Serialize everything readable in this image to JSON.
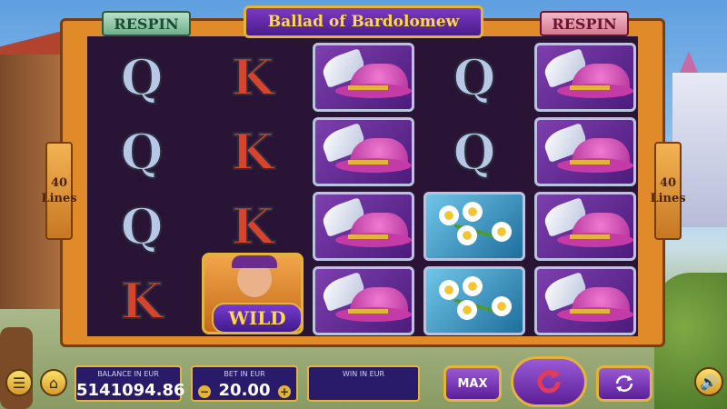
{
  "game": {
    "title": "Ballad of Bardolomew",
    "respin_left": "RESPIN",
    "respin_right": "RESPIN",
    "lines_left": {
      "count": "40",
      "label": "Lines"
    },
    "lines_right": {
      "count": "40",
      "label": "Lines"
    }
  },
  "reels": [
    [
      "Q",
      "Q",
      "Q",
      "K"
    ],
    [
      "K",
      "K",
      "K",
      "wild"
    ],
    [
      "hat",
      "hat",
      "hat",
      "hat"
    ],
    [
      "Q",
      "Q",
      "flower",
      "flower"
    ],
    [
      "hat",
      "hat",
      "hat",
      "hat"
    ]
  ],
  "symbols": {
    "wild_label": "WILD"
  },
  "bottom_bar": {
    "balance_label": "BALANCE IN EUR",
    "balance_value": "5141094.86",
    "bet_label": "BET IN EUR",
    "bet_value": "20.00",
    "win_label": "WIN IN EUR",
    "win_value": "",
    "max_label": "MAX",
    "minus_label": "−",
    "plus_label": "+"
  },
  "icons": {
    "menu": "menu-icon",
    "home": "home-icon",
    "spin": "spin-arrow-icon",
    "autoplay": "autoplay-icon",
    "sound": "speaker-icon"
  }
}
